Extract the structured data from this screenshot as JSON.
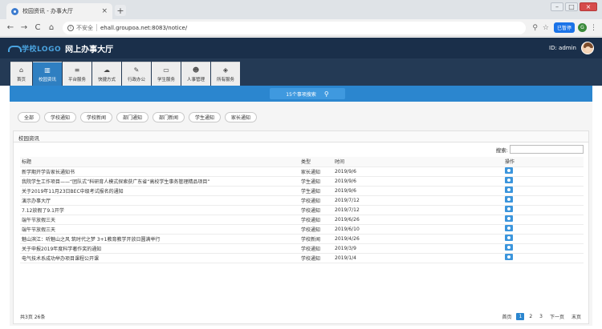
{
  "browser": {
    "tab_title": "校园资讯 - 办事大厅",
    "tab_close": "×",
    "new_tab": "+",
    "insecure_label": "不安全",
    "url": "ehall.groupoa.net:8083/notice/",
    "paused_label": "已暂停",
    "profile_letter": "G"
  },
  "header": {
    "logo_text": "学校LOGO",
    "app_title": "网上办事大厅",
    "user_label": "ID: admin"
  },
  "nav": {
    "items": [
      {
        "icon": "home-icon",
        "label": "首页"
      },
      {
        "icon": "chart-icon",
        "label": "校园资讯"
      },
      {
        "icon": "list-icon",
        "label": "平台服务"
      },
      {
        "icon": "cloud-icon",
        "label": "快捷方式"
      },
      {
        "icon": "pen-icon",
        "label": "行政办公"
      },
      {
        "icon": "monitor-icon",
        "label": "学生服务"
      },
      {
        "icon": "people-icon",
        "label": "人事管理"
      },
      {
        "icon": "stack-icon",
        "label": "所有服务"
      }
    ],
    "active_index": 1
  },
  "search": {
    "label": "15个事项搜索"
  },
  "filters": [
    "全部",
    "学校通知",
    "学校新闻",
    "部门通知",
    "部门新闻",
    "学生通知",
    "家长通知"
  ],
  "panel": {
    "title": "校园资讯",
    "filter_label": "搜索:"
  },
  "table": {
    "headers": [
      "标题",
      "类型",
      "时间",
      "操作"
    ],
    "rows": [
      [
        "新学期开学告家长通知书",
        "家长通知",
        "2019/9/6"
      ],
      [
        "我院学生工作项目——“团队式”科研育人模式探索获广东省“高校学生事务管理精品项目”",
        "学生通知",
        "2019/9/6"
      ],
      [
        "关于2019年11月23日BEC中级考试报名的通知",
        "学生通知",
        "2019/9/6"
      ],
      [
        "演示办事大厅",
        "学校通知",
        "2019/7/12"
      ],
      [
        "7.12放假了9.1开学",
        "学校通知",
        "2019/7/12"
      ],
      [
        "端午节放假三天",
        "学校通知",
        "2019/6/26"
      ],
      [
        "端午节放假三天",
        "学校通知",
        "2019/6/10"
      ],
      [
        "魅山滨江：听魅山之风 筑时代之梦 3+1教育教学开放日圆满举行",
        "学校新闻",
        "2019/4/26"
      ],
      [
        "关于申报2019年度科学著作奖的通知",
        "学校通知",
        "2019/3/9"
      ],
      [
        "电气技术系成功举办项目课程公开课",
        "学校通知",
        "2019/1/4"
      ]
    ]
  },
  "footer": {
    "total": "共3页 26条",
    "first": "首页",
    "pages": [
      "1",
      "2",
      "3"
    ],
    "current_page": "1",
    "next": "下一页",
    "last": "末页"
  }
}
